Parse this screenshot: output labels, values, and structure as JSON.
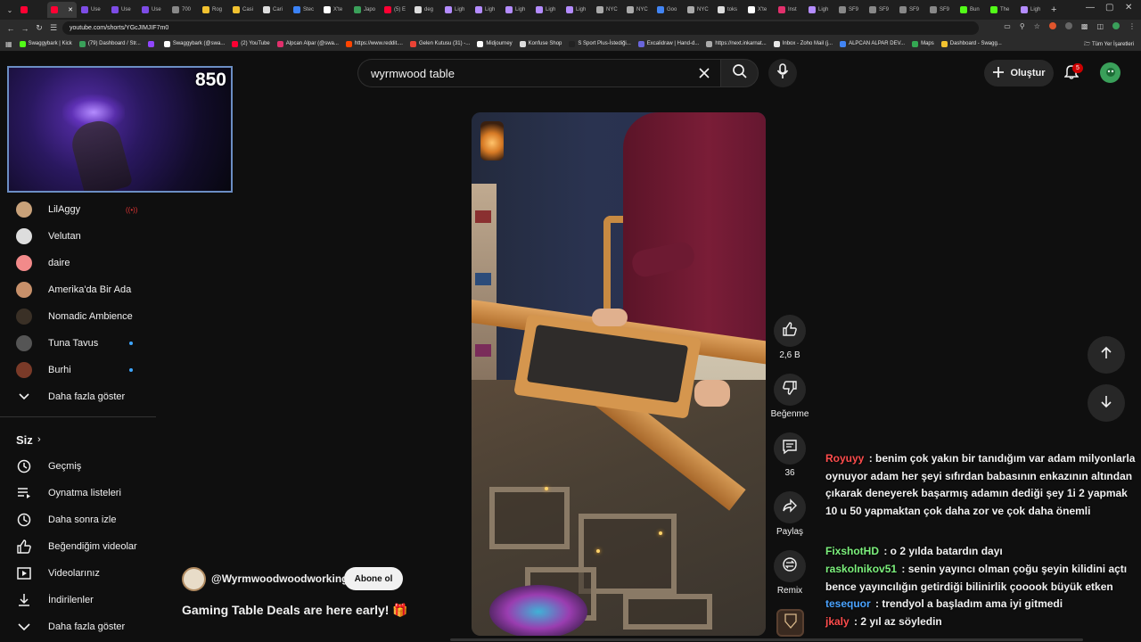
{
  "browser": {
    "tabs": [
      {
        "label": "",
        "color": "#ff0033"
      },
      {
        "label": "",
        "color": "#ff0033",
        "active": true
      },
      {
        "label": "Use",
        "color": "#7d4ce6"
      },
      {
        "label": "Use",
        "color": "#7d4ce6"
      },
      {
        "label": "Use",
        "color": "#7d4ce6"
      },
      {
        "label": "700",
        "color": "#888888"
      },
      {
        "label": "Rog",
        "color": "#f2c230"
      },
      {
        "label": "Casi",
        "color": "#f2c230"
      },
      {
        "label": "Cari",
        "color": "#dddddd"
      },
      {
        "label": "Stec",
        "color": "#3b82f6"
      },
      {
        "label": "X'te",
        "color": "#ffffff"
      },
      {
        "label": "Japo",
        "color": "#3aa05a"
      },
      {
        "label": "(5) E",
        "color": "#ff0033"
      },
      {
        "label": "deg",
        "color": "#dddddd"
      },
      {
        "label": "Ligh",
        "color": "#b48cff"
      },
      {
        "label": "Ligh",
        "color": "#b48cff"
      },
      {
        "label": "Ligh",
        "color": "#b48cff"
      },
      {
        "label": "Ligh",
        "color": "#b48cff"
      },
      {
        "label": "Ligh",
        "color": "#b48cff"
      },
      {
        "label": "NYC",
        "color": "#aaaaaa"
      },
      {
        "label": "NYC",
        "color": "#aaaaaa"
      },
      {
        "label": "Goo",
        "color": "#4285f4"
      },
      {
        "label": "NYC",
        "color": "#aaaaaa"
      },
      {
        "label": "toks",
        "color": "#dddddd"
      },
      {
        "label": "X'te",
        "color": "#ffffff"
      },
      {
        "label": "Inst",
        "color": "#e1306c"
      },
      {
        "label": "Ligh",
        "color": "#b48cff"
      },
      {
        "label": "SF9",
        "color": "#888888"
      },
      {
        "label": "SF9",
        "color": "#888888"
      },
      {
        "label": "SF9",
        "color": "#888888"
      },
      {
        "label": "SF9",
        "color": "#888888"
      },
      {
        "label": "Bun",
        "color": "#53fc18"
      },
      {
        "label": "The",
        "color": "#53fc18"
      },
      {
        "label": "Ligh",
        "color": "#b48cff"
      }
    ],
    "url": "youtube.com/shorts/YGcJIMJIF7m0",
    "bookmarks": [
      {
        "label": "Swaggybark | Kick",
        "color": "#53fc18"
      },
      {
        "label": "(79) Dashboard / Str...",
        "color": "#3aa05a"
      },
      {
        "label": "",
        "color": "#9146ff"
      },
      {
        "label": "Swaggybark (@swa...",
        "color": "#ffffff"
      },
      {
        "label": "(2) YouTube",
        "color": "#ff0033"
      },
      {
        "label": "Alpcan Alpar (@swa...",
        "color": "#e1306c"
      },
      {
        "label": "https://www.reddit....",
        "color": "#ff4500"
      },
      {
        "label": "Gelen Kutusu (31) -...",
        "color": "#ea4335"
      },
      {
        "label": "Midjourney",
        "color": "#ffffff"
      },
      {
        "label": "Konfuse Shop",
        "color": "#dddddd"
      },
      {
        "label": "S Sport Plus-İstediği...",
        "color": "#222222"
      },
      {
        "label": "Excalidraw | Hand-d...",
        "color": "#6965db"
      },
      {
        "label": "https://next.inkarnat...",
        "color": "#aaaaaa"
      },
      {
        "label": "Inbox - Zoho Mail (j...",
        "color": "#e8e8e8"
      },
      {
        "label": "ALPCAN ALPAR DEV...",
        "color": "#4285f4"
      },
      {
        "label": "Maps",
        "color": "#34a853"
      },
      {
        "label": "Dashboard - Swagg...",
        "color": "#f2c230"
      }
    ],
    "bookmarks_right": "Tüm Yer İşaretleri"
  },
  "webcam": {
    "viewer_count": "850"
  },
  "sidebar": {
    "subscriptions": [
      {
        "label": "LilAggy",
        "avatar_color": "#c9a27a",
        "live": true
      },
      {
        "label": "Velutan",
        "avatar_color": "#dddddd"
      },
      {
        "label": "daire",
        "avatar_color": "#f28a8a"
      },
      {
        "label": "Amerika'da Bir Ada",
        "avatar_color": "#c7906a"
      },
      {
        "label": "Nomadic Ambience",
        "avatar_color": "#3a3026"
      },
      {
        "label": "Tuna Tavus",
        "avatar_color": "#555555",
        "new": true
      },
      {
        "label": "Burhi",
        "avatar_color": "#7a3a28",
        "new": true
      }
    ],
    "show_more": "Daha fazla göster",
    "you_header": "Siz",
    "you_items": [
      {
        "label": "Geçmiş",
        "icon": "history-icon"
      },
      {
        "label": "Oynatma listeleri",
        "icon": "playlist-icon"
      },
      {
        "label": "Daha sonra izle",
        "icon": "watch-later-icon"
      },
      {
        "label": "Beğendiğim videolar",
        "icon": "like-icon"
      },
      {
        "label": "Videolarınız",
        "icon": "your-videos-icon"
      },
      {
        "label": "İndirilenler",
        "icon": "download-icon"
      },
      {
        "label": "Daha fazla göster",
        "icon": "chevron-down-icon"
      }
    ]
  },
  "header": {
    "search_value": "wyrmwood table",
    "create_label": "Oluştur",
    "notification_count": "5"
  },
  "short": {
    "channel": "@Wyrmwoodwoodworking",
    "subscribe_label": "Abone ol",
    "title": "Gaming Table Deals are here early! 🎁",
    "like_count": "2,6 B",
    "dislike_label": "Beğenme",
    "comment_count": "36",
    "share_label": "Paylaş",
    "remix_label": "Remix"
  },
  "chat": [
    {
      "user": "Royuyy",
      "user_color": "#ff4d4d",
      "text": "benim çok yakın bir tanıdığım var adam milyonlarla oynuyor adam her şeyi sıfırdan babasının enkazının altından çıkarak deneyerek başarmış adamın dediği şey 1i 2 yapmak 10 u 50 yapmaktan çok daha zor ve çok daha önemli"
    },
    {
      "user": "FixshotHD",
      "user_color": "#7cf07c",
      "text": "o 2 yılda batardın dayı"
    },
    {
      "user": "raskolnikov51",
      "user_color": "#7cf07c",
      "text": "senin yayıncı olman çoğu şeyin kilidini açtı bence yayıncılığın getirdiği bilinirlik çooook büyük etken"
    },
    {
      "user": "tesequor",
      "user_color": "#4aa3ff",
      "text": "trendyol a başladım ama iyi gitmedi"
    },
    {
      "user": "jkaly",
      "user_color": "#ff4d4d",
      "text": "2 yıl az söyledin"
    }
  ]
}
